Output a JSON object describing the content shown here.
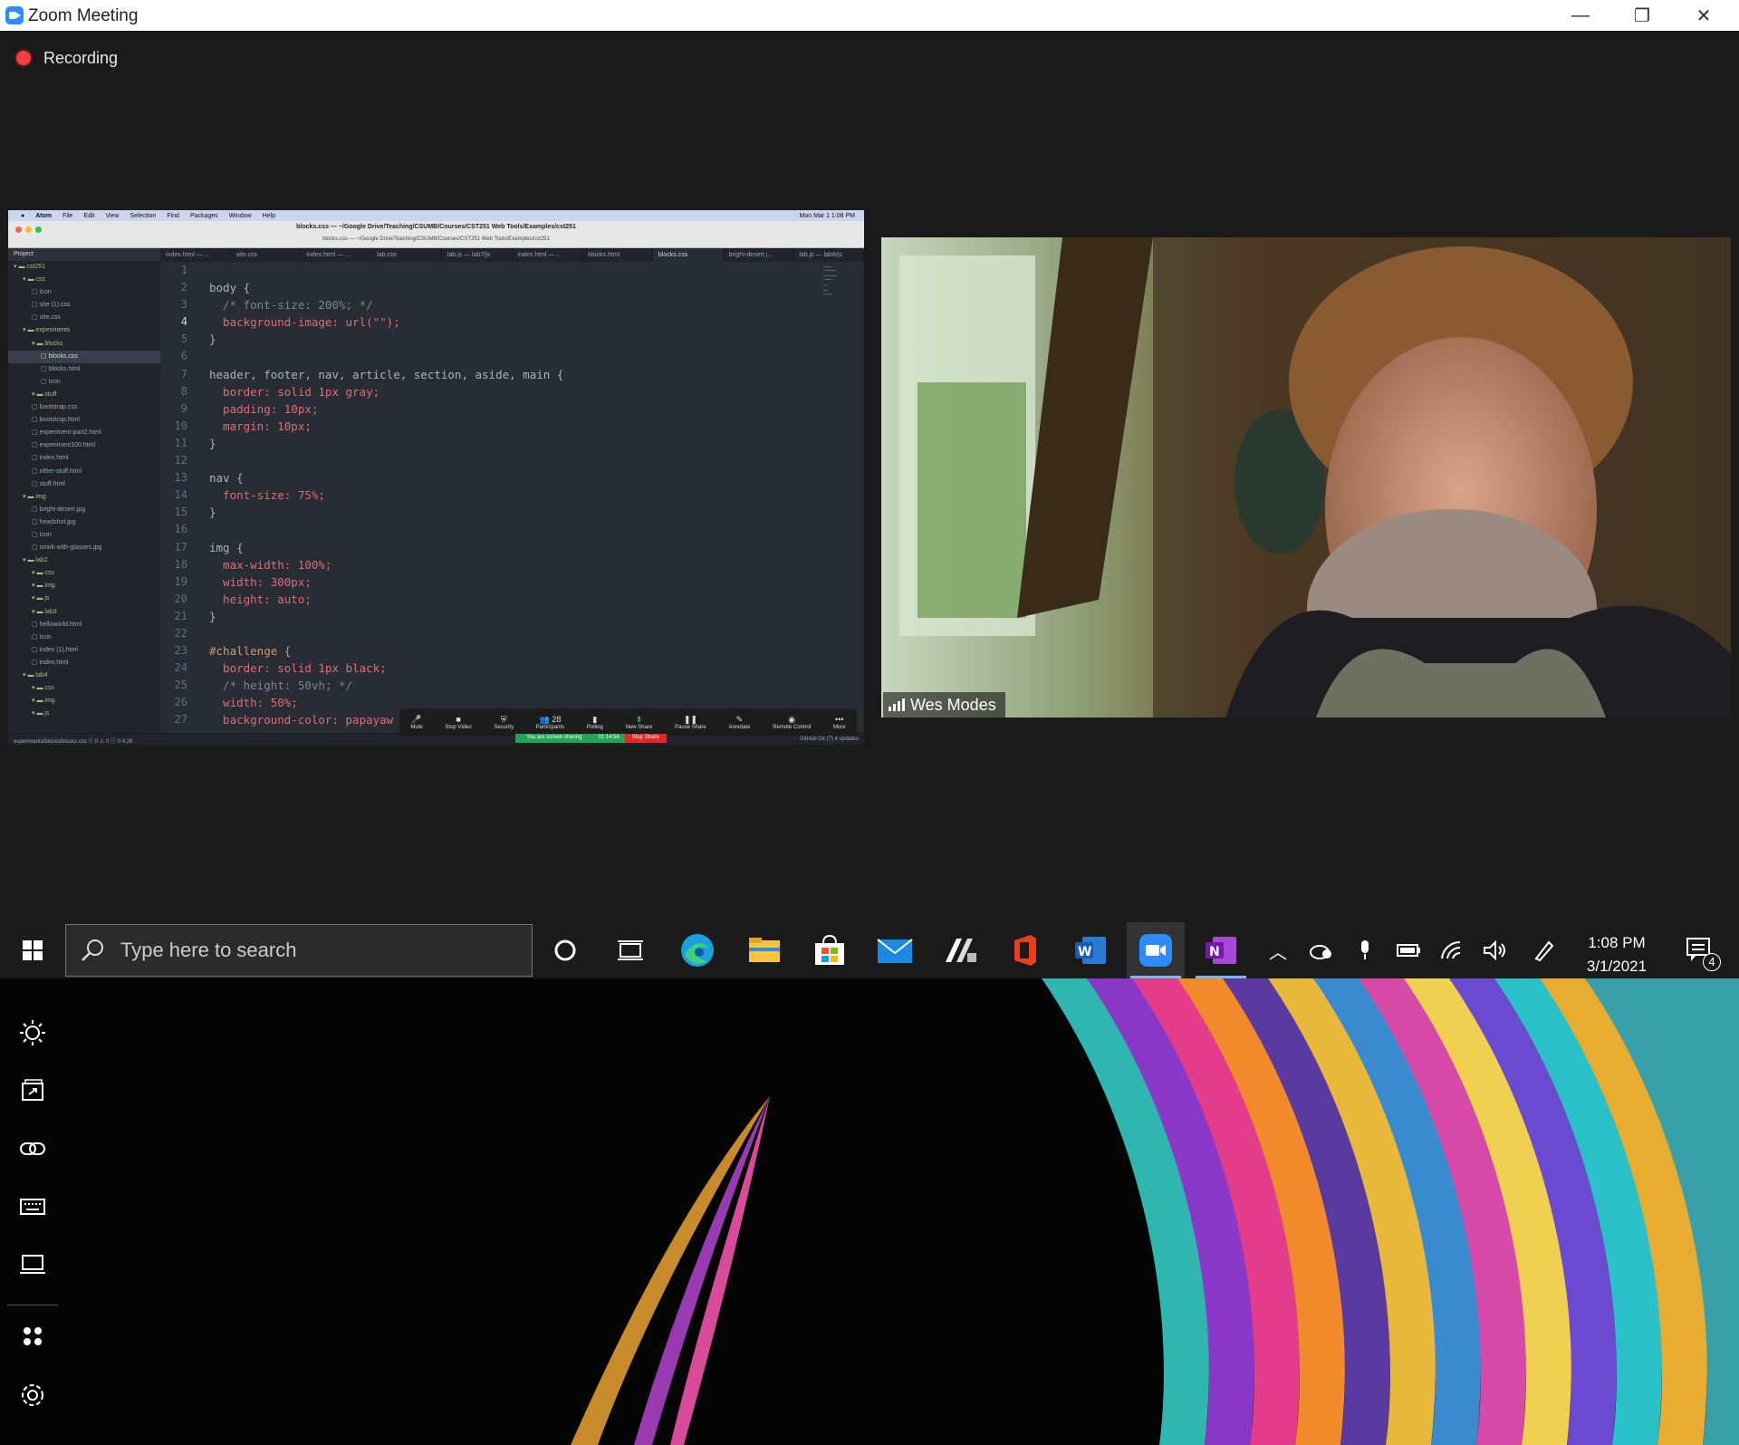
{
  "window": {
    "title": "Zoom Meeting",
    "minimize": "—",
    "restore": "❐",
    "close": "✕"
  },
  "recording": {
    "label": "Recording"
  },
  "shared_screen": {
    "mac_menubar": {
      "items": [
        "Atom",
        "File",
        "Edit",
        "View",
        "Selection",
        "Find",
        "Packages",
        "Window",
        "Help"
      ],
      "clock": "Mon Mar 1  1:08 PM"
    },
    "window_title": "blocks.css — ~/Google Drive/Teaching/CSUMB/Courses/CST251 Web Tools/Examples/cst251",
    "window_subtitle": "blocks.css — ~/Google Drive/Teaching/CSUMB/Courses/CST251 Web Tools/Examples/cst251",
    "tree_header": "Project",
    "tree": [
      {
        "label": "cst251",
        "depth": 0,
        "kind": "root"
      },
      {
        "label": "css",
        "depth": 1,
        "kind": "dir"
      },
      {
        "label": "Icon",
        "depth": 2,
        "kind": "file"
      },
      {
        "label": "site (1).css",
        "depth": 2,
        "kind": "file"
      },
      {
        "label": "site.css",
        "depth": 2,
        "kind": "file"
      },
      {
        "label": "experiments",
        "depth": 1,
        "kind": "dir"
      },
      {
        "label": "blocks",
        "depth": 2,
        "kind": "dir"
      },
      {
        "label": "blocks.css",
        "depth": 3,
        "kind": "sel"
      },
      {
        "label": "blocks.html",
        "depth": 3,
        "kind": "file"
      },
      {
        "label": "Icon",
        "depth": 3,
        "kind": "file"
      },
      {
        "label": "stuff",
        "depth": 2,
        "kind": "dir"
      },
      {
        "label": "bootstrap.css",
        "depth": 2,
        "kind": "file"
      },
      {
        "label": "bootstrap.html",
        "depth": 2,
        "kind": "file"
      },
      {
        "label": "experiment-part2.html",
        "depth": 2,
        "kind": "file"
      },
      {
        "label": "experiment100.html",
        "depth": 2,
        "kind": "file"
      },
      {
        "label": "index.html",
        "depth": 2,
        "kind": "file"
      },
      {
        "label": "other-stuff.html",
        "depth": 2,
        "kind": "file"
      },
      {
        "label": "stuff.html",
        "depth": 2,
        "kind": "file"
      },
      {
        "label": "img",
        "depth": 1,
        "kind": "dir"
      },
      {
        "label": "bright-desert.jpg",
        "depth": 2,
        "kind": "file"
      },
      {
        "label": "headshot.jpg",
        "depth": 2,
        "kind": "file"
      },
      {
        "label": "Icon",
        "depth": 2,
        "kind": "file"
      },
      {
        "label": "smirk-with-glasses.jpg",
        "depth": 2,
        "kind": "file"
      },
      {
        "label": "lab2",
        "depth": 1,
        "kind": "dir"
      },
      {
        "label": "css",
        "depth": 2,
        "kind": "dir"
      },
      {
        "label": "img",
        "depth": 2,
        "kind": "dir"
      },
      {
        "label": "js",
        "depth": 2,
        "kind": "dir"
      },
      {
        "label": "lab3",
        "depth": 2,
        "kind": "dir"
      },
      {
        "label": "helloworld.html",
        "depth": 2,
        "kind": "file"
      },
      {
        "label": "Icon",
        "depth": 2,
        "kind": "file"
      },
      {
        "label": "index (1).html",
        "depth": 2,
        "kind": "file"
      },
      {
        "label": "index.html",
        "depth": 2,
        "kind": "file"
      },
      {
        "label": "lab4",
        "depth": 1,
        "kind": "dir"
      },
      {
        "label": "css",
        "depth": 2,
        "kind": "dir"
      },
      {
        "label": "img",
        "depth": 2,
        "kind": "dir"
      },
      {
        "label": "js",
        "depth": 2,
        "kind": "dir"
      }
    ],
    "tabs": [
      {
        "label": "index.html — ...",
        "active": false
      },
      {
        "label": "site.css",
        "active": false
      },
      {
        "label": "index.html — ...",
        "active": false
      },
      {
        "label": "lab.css",
        "active": false
      },
      {
        "label": "lab.js — lab7/js",
        "active": false
      },
      {
        "label": "index.html — ...",
        "active": false
      },
      {
        "label": "blocks.html",
        "active": false
      },
      {
        "label": "blocks.css",
        "active": true
      },
      {
        "label": "bright-desert.j...",
        "active": false
      },
      {
        "label": "lab.js — lab8/js",
        "active": false
      }
    ],
    "line_numbers": [
      "1",
      "2",
      "3",
      "4",
      "5",
      "6",
      "7",
      "8",
      "9",
      "10",
      "11",
      "12",
      "13",
      "14",
      "15",
      "16",
      "17",
      "18",
      "19",
      "20",
      "21",
      "22",
      "23",
      "24",
      "25",
      "26",
      "27"
    ],
    "code_lines": [
      "",
      "body {",
      "  /* font-size: 200%; */",
      "  background-image: url(\"\");",
      "}",
      "",
      "header, footer, nav, article, section, aside, main {",
      "  border: solid 1px gray;",
      "  padding: 10px;",
      "  margin: 10px;",
      "}",
      "",
      "nav {",
      "  font-size: 75%;",
      "}",
      "",
      "img {",
      "  max-width: 100%;",
      "  width: 300px;",
      "  height: auto;",
      "}",
      "",
      "#challenge {",
      "  border: solid 1px black;",
      "  /* height: 50vh; */",
      "  width: 50%;",
      "  background-color: papayaw"
    ],
    "status_left": "experiments/blocks/blocks.css   ⓧ 0 ⚠ 0 ⓘ 0   4:26",
    "meeting_controls": [
      {
        "label": "Mute",
        "icon": "🎤"
      },
      {
        "label": "Stop Video",
        "icon": "■"
      },
      {
        "label": "Security",
        "icon": "⛨"
      },
      {
        "label": "Participants",
        "icon": "👥 28"
      },
      {
        "label": "Polling",
        "icon": "▮"
      },
      {
        "label": "New Share",
        "icon": "⬆"
      },
      {
        "label": "Pause Share",
        "icon": "❚❚"
      },
      {
        "label": "Annotate",
        "icon": "✎"
      },
      {
        "label": "Remote Control",
        "icon": "◉"
      },
      {
        "label": "More",
        "icon": "•••"
      }
    ],
    "sharing_status": "You are screen sharing",
    "sharing_timer": "01:14:56",
    "stop_share": "Stop Share",
    "status_right": "GitHub   Git (7)   4 updates"
  },
  "video": {
    "participant_name": "Wes Modes"
  },
  "taskbar": {
    "search_placeholder": "Type here to search",
    "time": "1:08 PM",
    "date": "3/1/2021",
    "notification_count": "4",
    "pinned": [
      {
        "name": "cortana-icon"
      },
      {
        "name": "task-view-icon"
      },
      {
        "name": "edge-icon"
      },
      {
        "name": "file-explorer-icon"
      },
      {
        "name": "store-icon"
      },
      {
        "name": "mail-icon"
      },
      {
        "name": "app-icon"
      },
      {
        "name": "office-icon"
      },
      {
        "name": "word-icon"
      },
      {
        "name": "zoom-icon"
      },
      {
        "name": "onenote-icon"
      }
    ]
  },
  "colors": {
    "zoom_bg": "#1a1a1a",
    "zoom_blue": "#2d8cff",
    "recording_red": "#f04040",
    "taskbar_bg": "#1b1b1b",
    "accent": "#76b9ed"
  }
}
